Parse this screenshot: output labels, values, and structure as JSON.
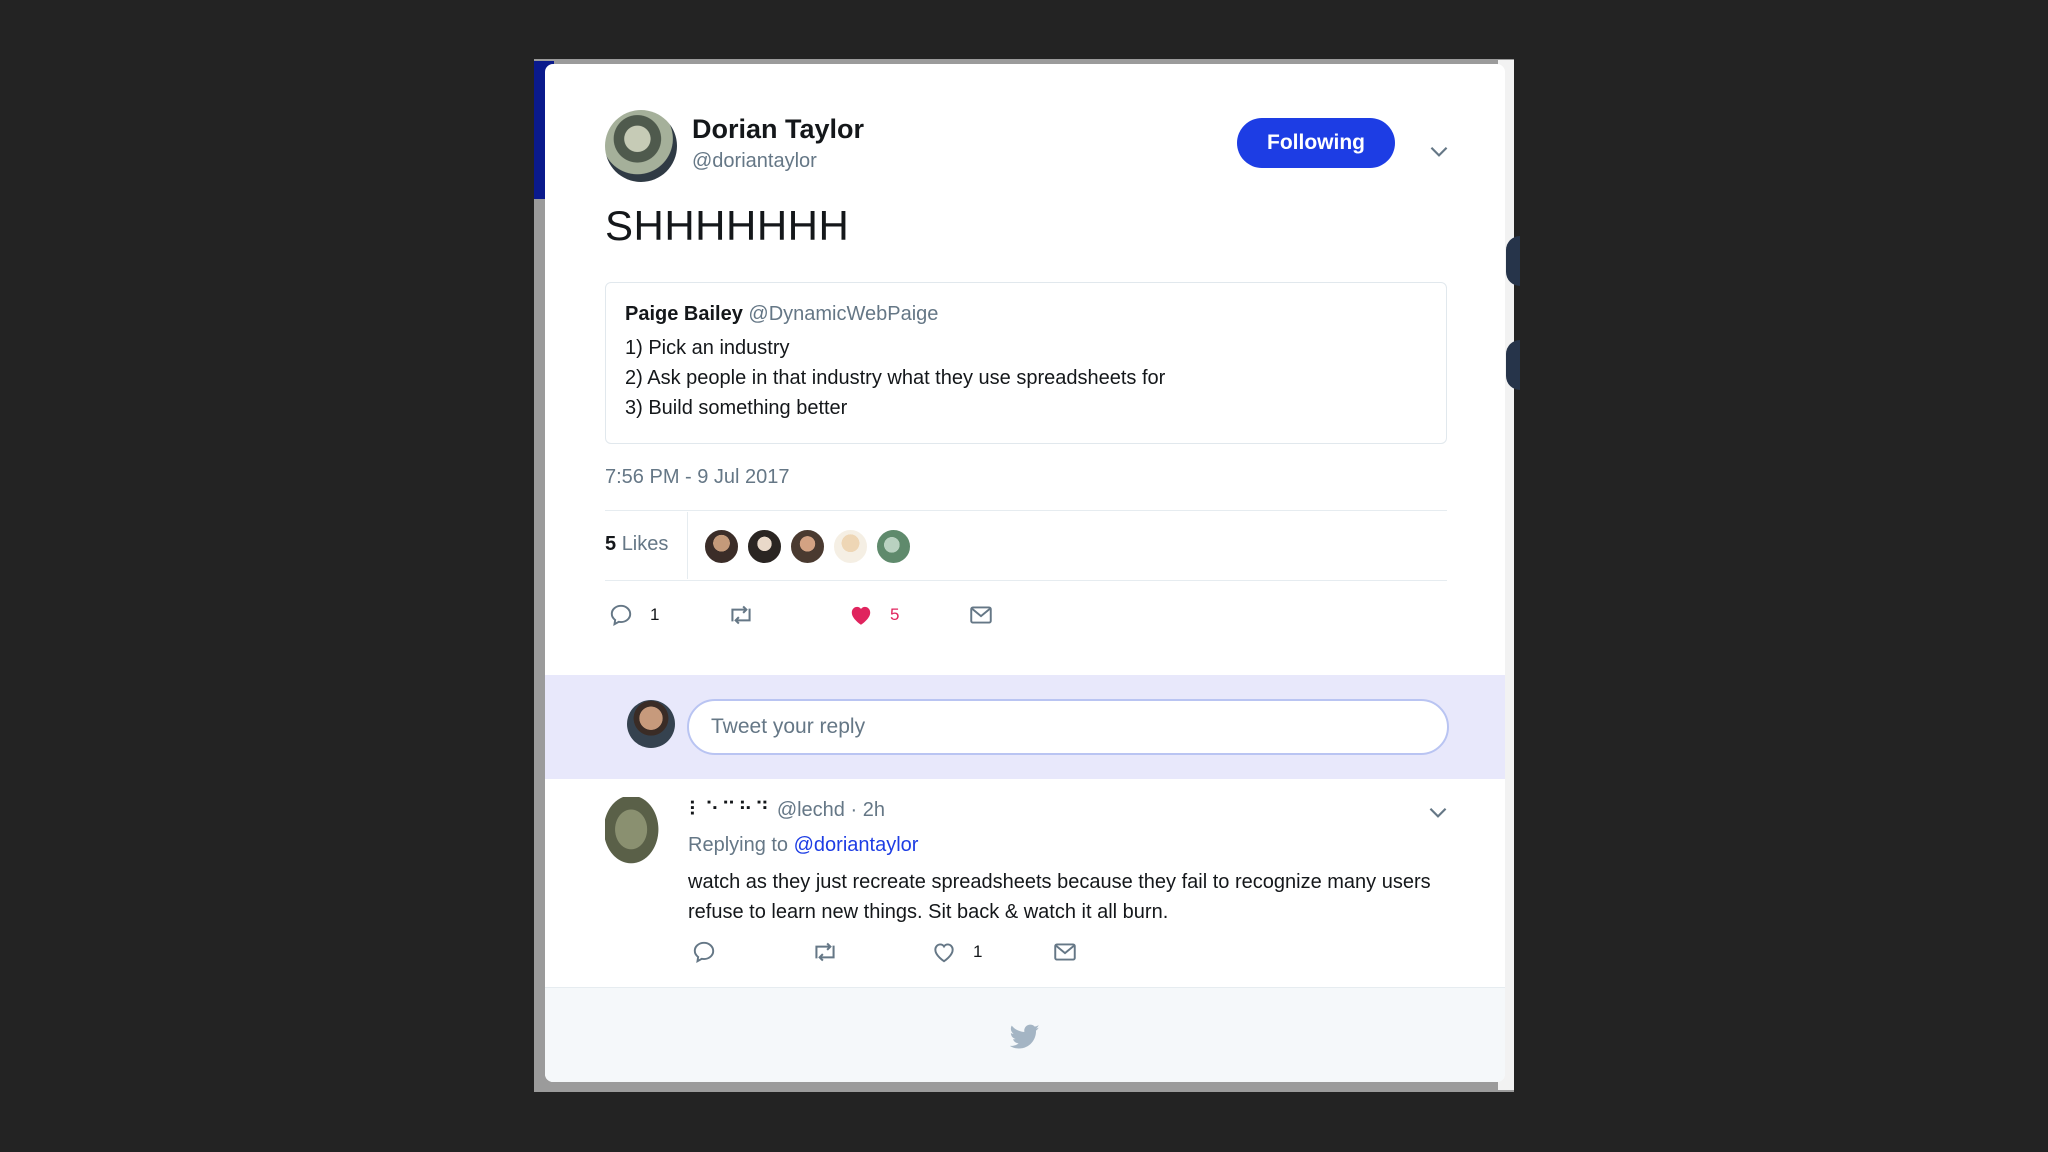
{
  "tweet": {
    "author_name": "Dorian Taylor",
    "author_handle": "@doriantaylor",
    "follow_label": "Following",
    "text": "SHHHHHHH",
    "timestamp": "7:56 PM - 9 Jul 2017",
    "quoted": {
      "name": "Paige Bailey",
      "handle": "@DynamicWebPaige",
      "lines": [
        "1) Pick an industry",
        "2) Ask people in that industry what they use spreadsheets for",
        "3) Build something better"
      ]
    },
    "likes": {
      "count": "5",
      "label": "Likes"
    },
    "actions": {
      "reply_count": "1",
      "like_count": "5"
    }
  },
  "reply_box": {
    "placeholder": "Tweet your reply"
  },
  "reply": {
    "display_name": "⠇⠑⠉⠓⠙",
    "handle": "@lechd",
    "age": "2h",
    "replying_prefix": "Replying to",
    "replying_to": "@doriantaylor",
    "text": "watch as they just recreate spreadsheets because they fail to recognize many users refuse to learn new things. Sit back & watch it all burn.",
    "like_count": "1"
  },
  "colors": {
    "accent": "#1d3de4",
    "like": "#e0245e",
    "reply_bar": "#e8e8fb",
    "muted": "#657786"
  },
  "icons": [
    "chevron-down-icon",
    "reply-icon",
    "retweet-icon",
    "heart-icon",
    "envelope-icon",
    "twitter-bird-icon"
  ]
}
